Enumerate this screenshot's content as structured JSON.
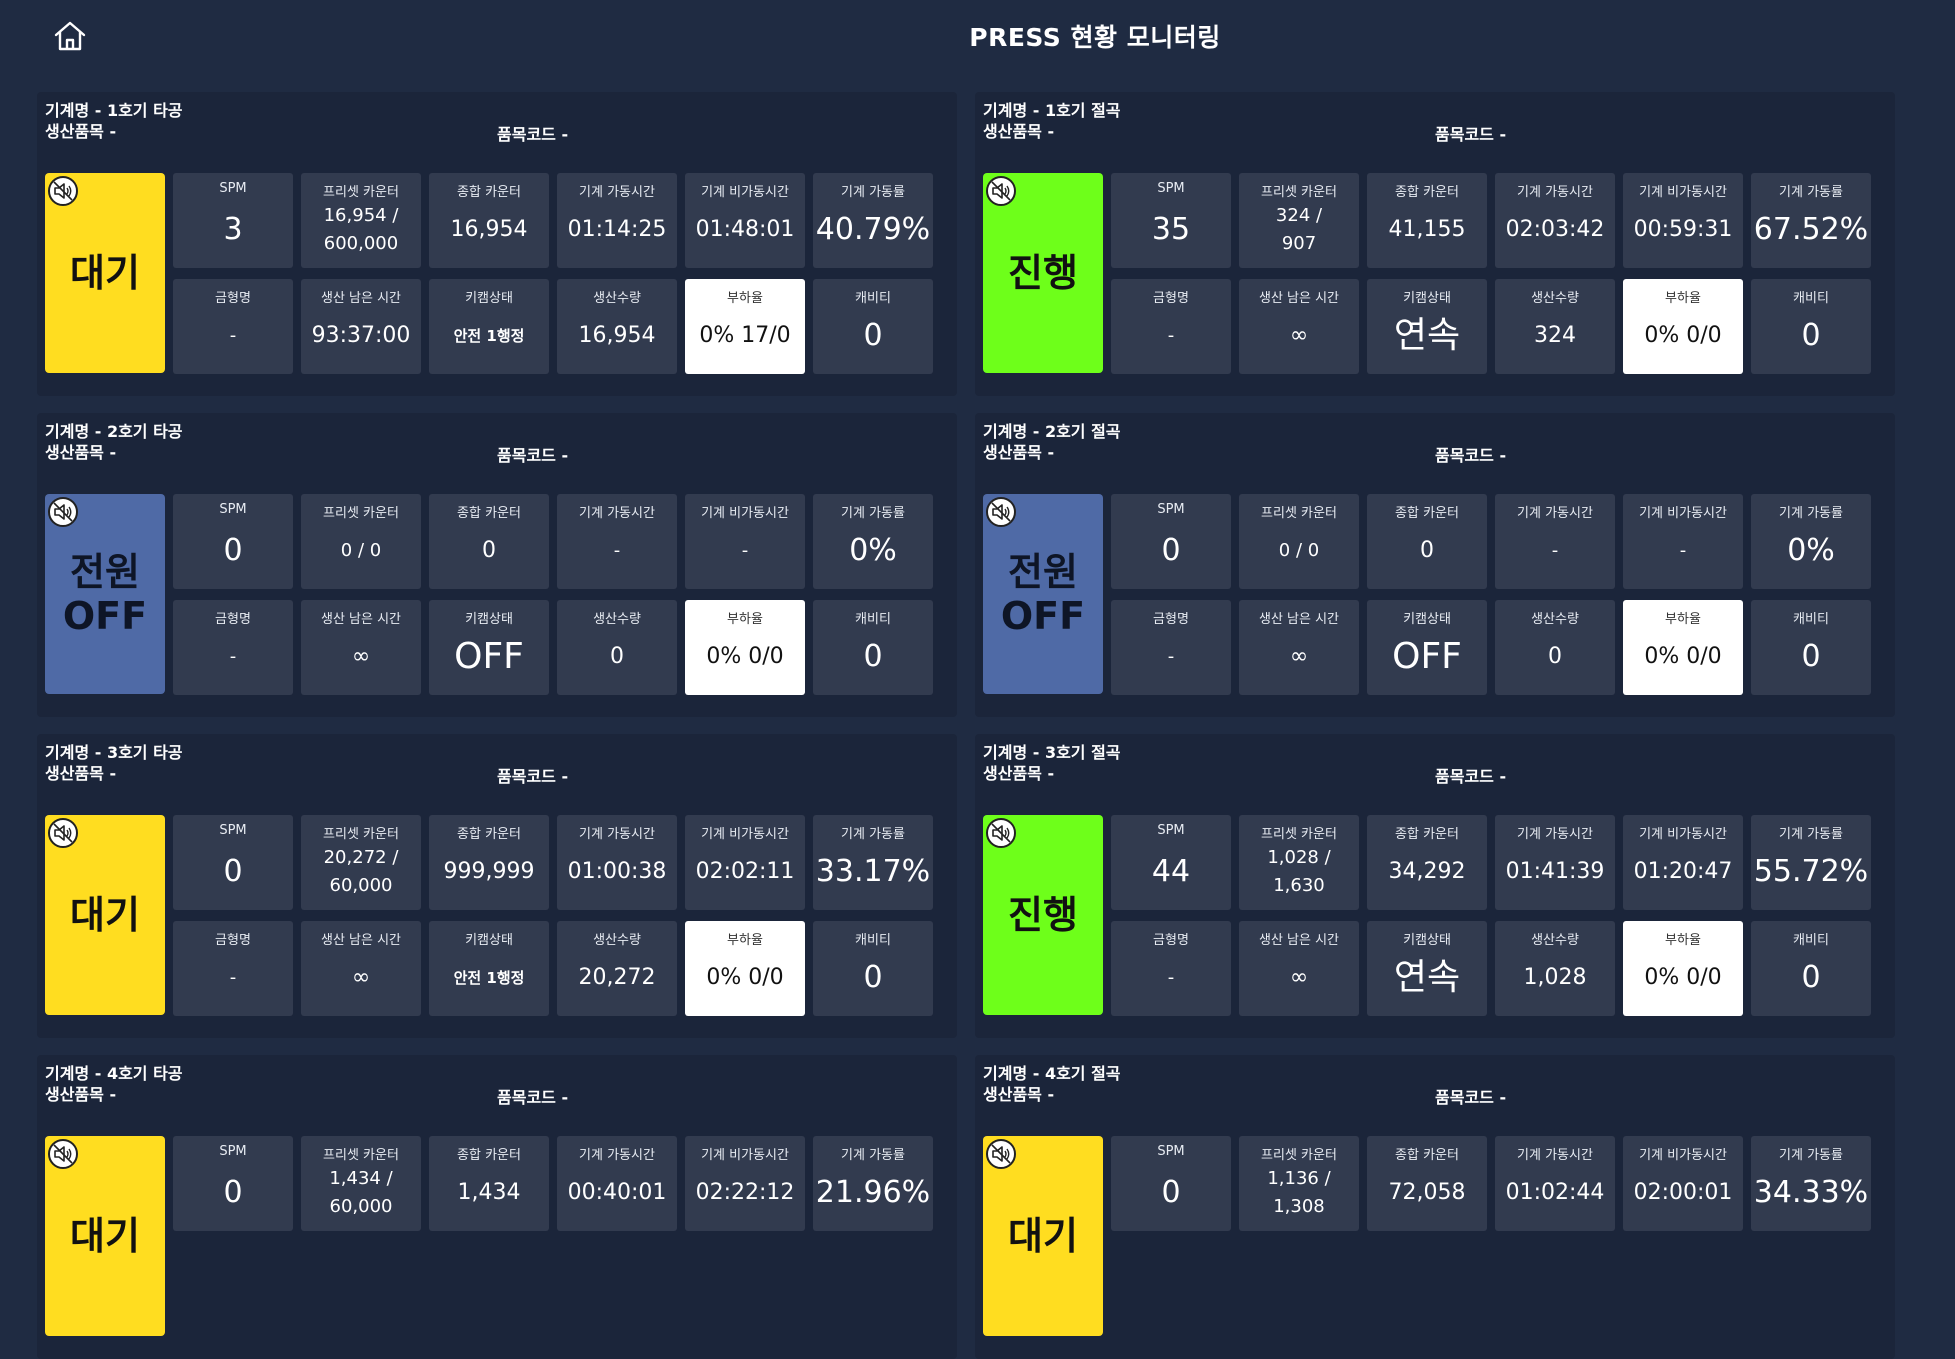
{
  "header": {
    "title": "PRESS 현황 모니터링"
  },
  "labels": {
    "spm": "SPM",
    "preset": "프리셋 카운터",
    "total": "종합 카운터",
    "run_time": "기계 가동시간",
    "idle_time": "기계 비가동시간",
    "rate": "기계 가동률",
    "mold": "금형명",
    "remain": "생산 남은 시간",
    "keycam": "키캠상태",
    "qty": "생산수량",
    "load": "부하율",
    "cavity": "캐비티"
  },
  "machines": [
    {
      "name": "기계명 - 1호기 타공",
      "product": "생산품목 -",
      "code": "품목코드 -",
      "status": "대기",
      "status_kind": "wait",
      "spm": "3",
      "preset": "16,954 / 600,000",
      "total": "16,954",
      "run_time": "01:14:25",
      "idle_time": "01:48:01",
      "rate": "40.79%",
      "mold": "-",
      "remain": "93:37:00",
      "keycam": "안전 1행정",
      "qty": "16,954",
      "load": "0% 17/0",
      "cavity": "0"
    },
    {
      "name": "기계명 - 1호기 절곡",
      "product": "생산품목 -",
      "code": "품목코드 -",
      "status": "진행",
      "status_kind": "run",
      "spm": "35",
      "preset": "324 / 907",
      "total": "41,155",
      "run_time": "02:03:42",
      "idle_time": "00:59:31",
      "rate": "67.52%",
      "mold": "-",
      "remain": "∞",
      "keycam": "연속",
      "qty": "324",
      "load": "0% 0/0",
      "cavity": "0"
    },
    {
      "name": "기계명 - 2호기 타공",
      "product": "생산품목 -",
      "code": "품목코드 -",
      "status": "전원 OFF",
      "status_kind": "off",
      "spm": "0",
      "preset": "0 / 0",
      "total": "0",
      "run_time": "-",
      "idle_time": "-",
      "rate": "0%",
      "mold": "-",
      "remain": "∞",
      "keycam": "OFF",
      "qty": "0",
      "load": "0% 0/0",
      "cavity": "0"
    },
    {
      "name": "기계명 - 2호기 절곡",
      "product": "생산품목 -",
      "code": "품목코드 -",
      "status": "전원 OFF",
      "status_kind": "off",
      "spm": "0",
      "preset": "0 / 0",
      "total": "0",
      "run_time": "-",
      "idle_time": "-",
      "rate": "0%",
      "mold": "-",
      "remain": "∞",
      "keycam": "OFF",
      "qty": "0",
      "load": "0% 0/0",
      "cavity": "0"
    },
    {
      "name": "기계명 - 3호기 타공",
      "product": "생산품목 -",
      "code": "품목코드 -",
      "status": "대기",
      "status_kind": "wait",
      "spm": "0",
      "preset": "20,272 / 60,000",
      "total": "999,999",
      "run_time": "01:00:38",
      "idle_time": "02:02:11",
      "rate": "33.17%",
      "mold": "-",
      "remain": "∞",
      "keycam": "안전 1행정",
      "qty": "20,272",
      "load": "0% 0/0",
      "cavity": "0"
    },
    {
      "name": "기계명 - 3호기 절곡",
      "product": "생산품목 -",
      "code": "품목코드 -",
      "status": "진행",
      "status_kind": "run",
      "spm": "44",
      "preset": "1,028 / 1,630",
      "total": "34,292",
      "run_time": "01:41:39",
      "idle_time": "01:20:47",
      "rate": "55.72%",
      "mold": "-",
      "remain": "∞",
      "keycam": "연속",
      "qty": "1,028",
      "load": "0% 0/0",
      "cavity": "0"
    },
    {
      "name": "기계명 - 4호기 타공",
      "product": "생산품목 -",
      "code": "품목코드 -",
      "status": "대기",
      "status_kind": "wait",
      "spm": "0",
      "preset": "1,434 / 60,000",
      "total": "1,434",
      "run_time": "00:40:01",
      "idle_time": "02:22:12",
      "rate": "21.96%"
    },
    {
      "name": "기계명 - 4호기 절곡",
      "product": "생산품목 -",
      "code": "품목코드 -",
      "status": "대기",
      "status_kind": "wait",
      "spm": "0",
      "preset": "1,136 / 1,308",
      "total": "72,058",
      "run_time": "01:02:44",
      "idle_time": "02:00:01",
      "rate": "34.33%"
    }
  ]
}
